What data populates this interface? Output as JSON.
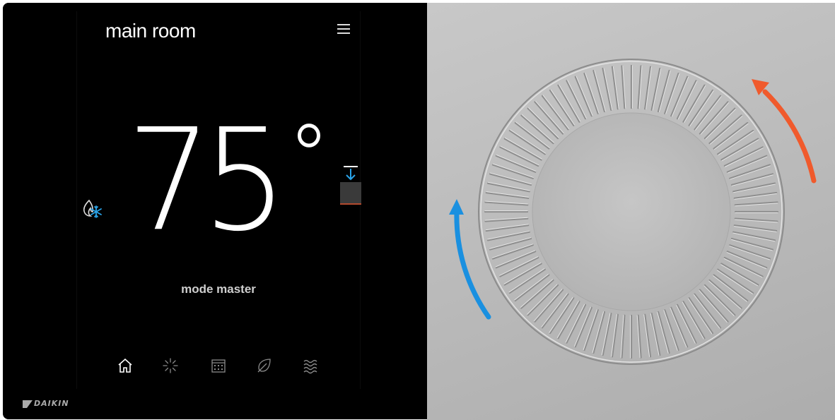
{
  "screen": {
    "room_name": "main room",
    "temperature": "75",
    "temperature_unit_symbol": "°",
    "mode_label": "mode master",
    "brand": "DAIKIN",
    "nav_items": [
      "home-icon",
      "fan-icon",
      "schedule-icon",
      "leaf-icon",
      "humidity-icon"
    ],
    "mode_icon": "heat-cool-icon",
    "colors": {
      "screen_background": "#000000",
      "text_primary": "#ffffff",
      "cool_accent": "#29a3e8",
      "heat_accent": "#b24a2e"
    }
  },
  "dial": {
    "left_arrow_color": "#1a90e0",
    "right_arrow_color": "#f05a2c",
    "left_arrow_direction": "clockwise-up",
    "right_arrow_direction": "counterclockwise-up",
    "panel_color": "#c0c0c0"
  }
}
